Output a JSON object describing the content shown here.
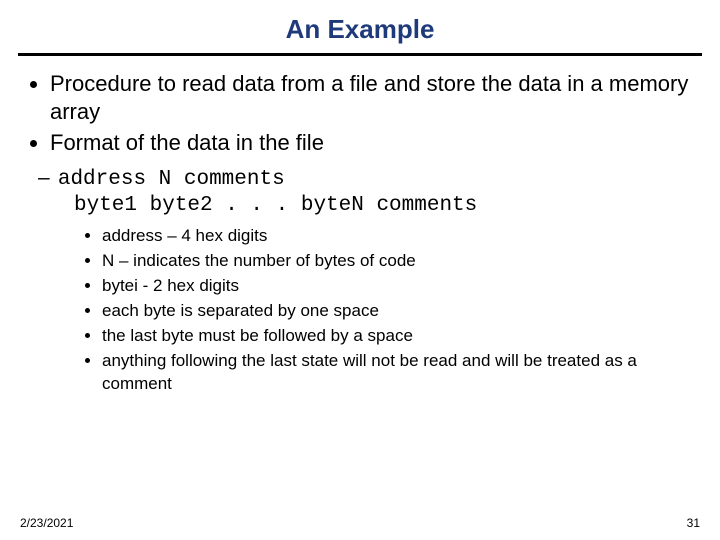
{
  "title": "An Example",
  "bullets_level1": [
    "Procedure to read data from a file and store the data in a memory array",
    "Format of the data in the file"
  ],
  "format_block": {
    "line1": "address N comments",
    "line2": "byte1 byte2 . . . byteN comments"
  },
  "bullets_level3": [
    "address – 4 hex digits",
    "N – indicates the number of bytes of code",
    "bytei  - 2 hex digits",
    "each byte is separated by one space",
    "the last byte must be followed by a space",
    "anything following the last state will not be read and will be treated as a comment"
  ],
  "footer": {
    "date": "2/23/2021",
    "page": "31"
  }
}
